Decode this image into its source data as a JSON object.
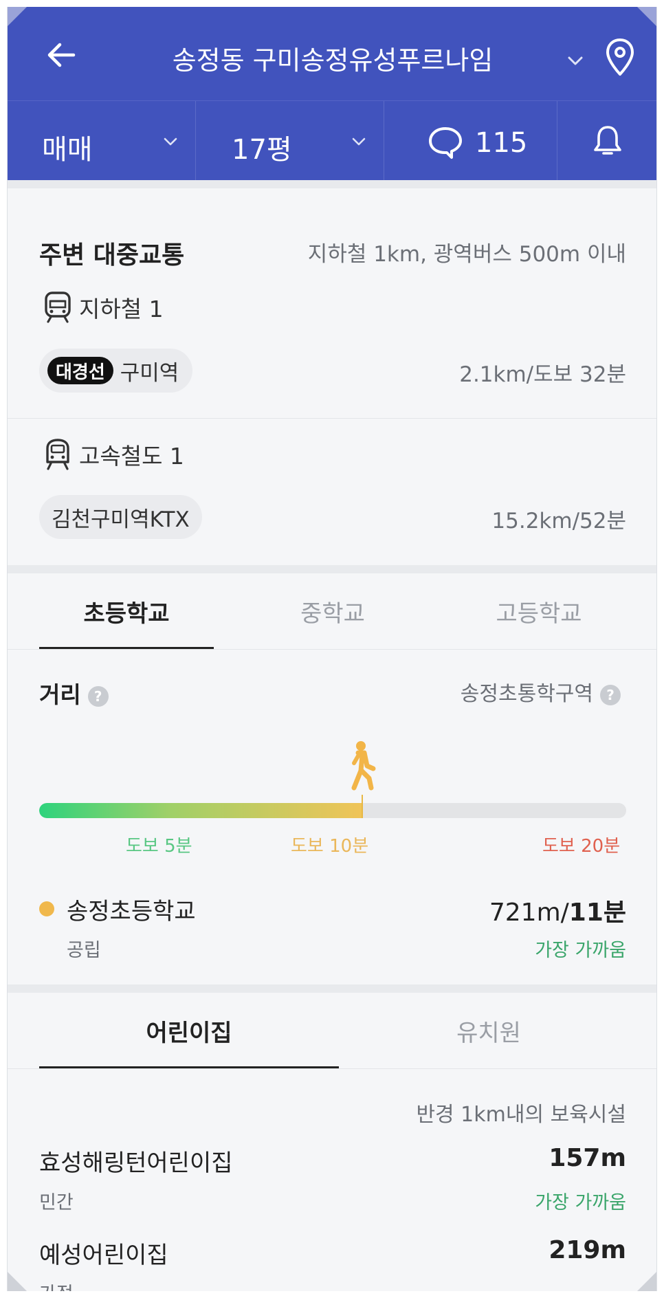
{
  "header": {
    "title": "송정동 구미송정유성푸르나임"
  },
  "filters": {
    "trade_type": "매매",
    "size": "17평",
    "comment_count": "115"
  },
  "transit": {
    "title": "주변 대중교통",
    "criteria": "지하철 1km, 광역버스 500m 이내",
    "subway": {
      "label": "지하철 1",
      "line_badge": "대경선",
      "station": "구미역",
      "distance": "2.1km/도보 32분"
    },
    "ktx": {
      "label": "고속철도 1",
      "station": "김천구미역KTX",
      "distance": "15.2km/52분"
    }
  },
  "school_tabs": [
    "초등학교",
    "중학교",
    "고등학교"
  ],
  "school": {
    "distance_label": "거리",
    "zone_label": "송정초통학구역",
    "walk_fraction": 0.55,
    "scale": [
      "도보 5분",
      "도보 10분",
      "도보 20분"
    ],
    "scale_colors": [
      "#59c783",
      "#eab75a",
      "#e0614f"
    ],
    "name": "송정초등학교",
    "type": "공립",
    "distance_prefix": "721m/",
    "distance_time": "11분",
    "nearest": "가장 가까움"
  },
  "childcare_tabs": [
    "어린이집",
    "유치원"
  ],
  "childcare": {
    "radius_note": "반경 1km내의 보육시설",
    "items": [
      {
        "name": "효성해링턴어린이집",
        "type": "민간",
        "distance": "157m",
        "nearest": "가장 가까움"
      },
      {
        "name": "예성어린이집",
        "type": "가정",
        "distance": "219m"
      }
    ]
  },
  "colors": {
    "brand": "#4153bd",
    "accent_green": "#3aa56a",
    "school_dot": "#f0b84c"
  }
}
